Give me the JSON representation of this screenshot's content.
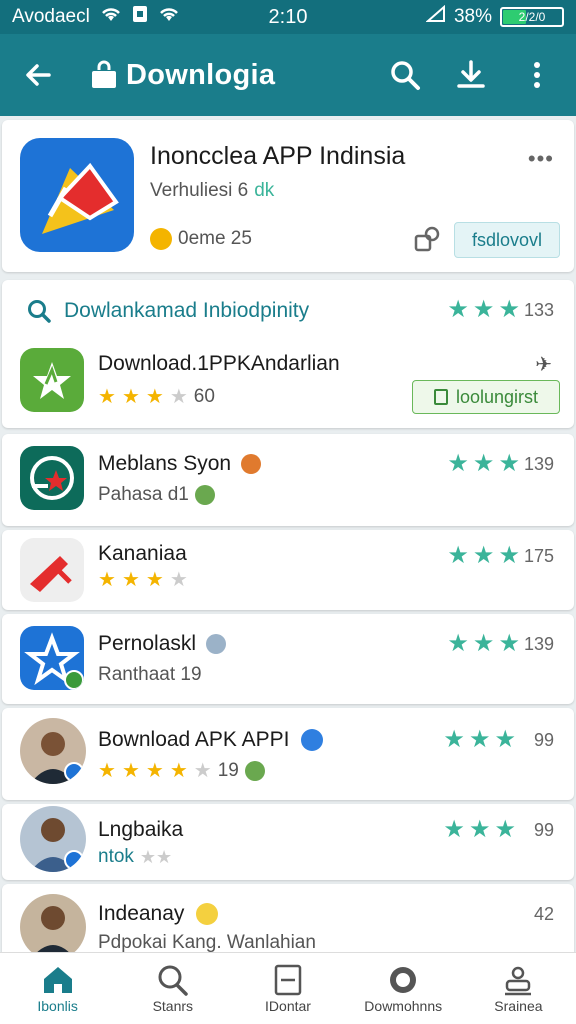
{
  "status_bar": {
    "carrier": "Avodaecl",
    "time": "2:10",
    "battery_percent": "38%",
    "battery_text": "2/2/0",
    "battery_level": 0.38
  },
  "app_bar": {
    "title": "Downlogia"
  },
  "featured": {
    "name": "Inoncclea APP Indinsia",
    "subtitle": "Verhuliesi 6",
    "badge": "dk",
    "meta": "0eme 25",
    "follow_label": "fsdlovovl"
  },
  "search_row": {
    "label": "Dowlankamad Inbiodpinity",
    "rating_count": "133"
  },
  "download_app": {
    "name": "Download.1PPKAndarlian",
    "rating_count": "60",
    "stars": 3,
    "button_label": "loolungirst"
  },
  "items": [
    {
      "name": "Meblans Syon",
      "sub": "Pahasa d1",
      "rating_count": "139"
    },
    {
      "name": "Kananiaa",
      "sub": "",
      "rating_count": "175",
      "stars": 3
    },
    {
      "name": "Pernolaskl",
      "sub": "Ranthaat 19",
      "rating_count": "139"
    },
    {
      "name": "Bownload APK APPI",
      "sub_count": "19",
      "rating_count": "99",
      "stars": 4
    },
    {
      "name": "Lngbaika",
      "sub": "ntok",
      "rating_count": "99",
      "stars": 3
    },
    {
      "name": "Indeanay",
      "sub": "Pdpokai Kang. Wanlahian",
      "rating_count": "42"
    }
  ],
  "bottom_nav": [
    {
      "label": "Ibonlis"
    },
    {
      "label": "Stanrs"
    },
    {
      "label": "IDontar"
    },
    {
      "label": "Dowmohnns"
    },
    {
      "label": "Srainea"
    }
  ],
  "colors": {
    "primary": "#1a7d8b",
    "accent_green": "#3bb49a",
    "star_yellow": "#f4b400"
  }
}
